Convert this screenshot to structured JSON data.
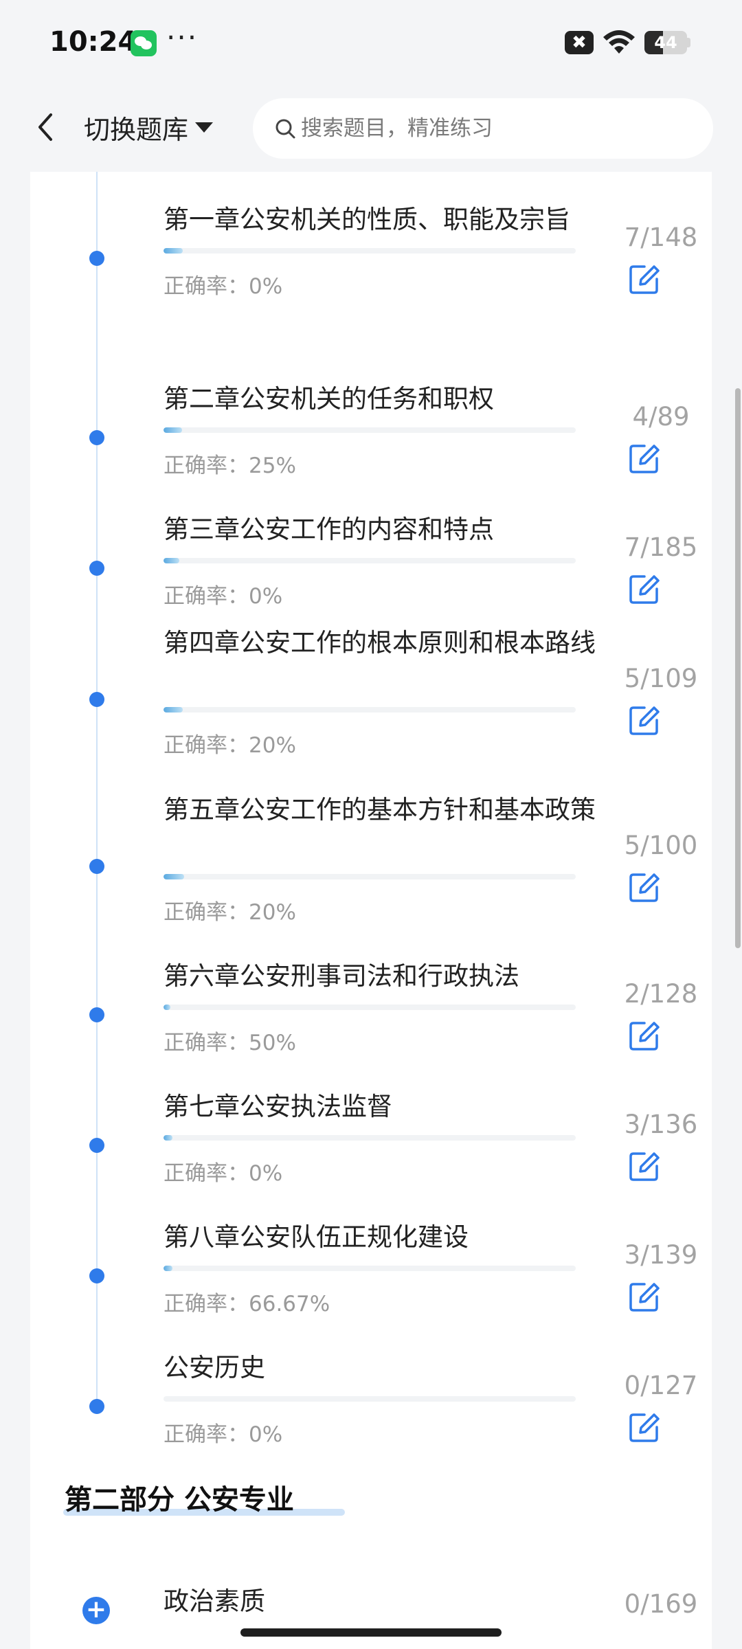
{
  "status_bar": {
    "time": "10:24",
    "more": "···",
    "x_badge": "✖",
    "battery_level": 44,
    "battery_text": "44"
  },
  "header": {
    "bank_switch_label": "切换题库",
    "search_placeholder": "搜索题目，精准练习"
  },
  "accent_color": "#2f7bea",
  "chapters": [
    {
      "title": "第一章公安机关的性质、职能及宗旨",
      "accuracy": "正确率：0%",
      "count": "7/148",
      "progress": 0.047
    },
    {
      "title": "第二章公安机关的任务和职权",
      "accuracy": "正确率：25%",
      "count": "4/89",
      "progress": 0.045
    },
    {
      "title": "第三章公安工作的内容和特点",
      "accuracy": "正确率：0%",
      "count": "7/185",
      "progress": 0.038
    },
    {
      "title": "第四章公安工作的根本原则和根本路线",
      "accuracy": "正确率：20%",
      "count": "5/109",
      "progress": 0.046
    },
    {
      "title": "第五章公安工作的基本方针和基本政策",
      "accuracy": "正确率：20%",
      "count": "5/100",
      "progress": 0.05
    },
    {
      "title": "第六章公安刑事司法和行政执法",
      "accuracy": "正确率：50%",
      "count": "2/128",
      "progress": 0.016
    },
    {
      "title": "第七章公安执法监督",
      "accuracy": "正确率：0%",
      "count": "3/136",
      "progress": 0.022
    },
    {
      "title": "第八章公安队伍正规化建设",
      "accuracy": "正确率：66.67%",
      "count": "3/139",
      "progress": 0.022
    },
    {
      "title": "公安历史",
      "accuracy": "正确率：0%",
      "count": "0/127",
      "progress": 0
    }
  ],
  "section2": {
    "title": "第二部分 公安专业",
    "first_item": {
      "title": "政治素质",
      "count": "0/169",
      "progress": 0
    }
  }
}
